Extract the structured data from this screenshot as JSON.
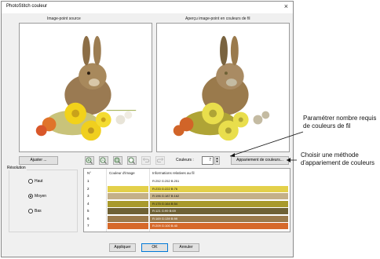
{
  "dialog": {
    "title": "PhotoStitch couleur",
    "close_glyph": "×"
  },
  "panels": {
    "source_label": "Image-point source",
    "preview_label": "Aperçu image-point en couleurs de fil",
    "source_image": "rabbit-with-flowers",
    "preview_image": "rabbit-with-flowers-thread-colors"
  },
  "toolbar": {
    "adjust_label": "Ajuster ...",
    "tools": [
      "zoom-in-icon",
      "zoom-out-icon",
      "zoom-fit-icon",
      "zoom-window-icon",
      "undo-icon",
      "redo-icon"
    ],
    "colors_label": "Couleurs :",
    "colors_value": "7",
    "matching_label": "Appariement de couleurs..."
  },
  "resolution": {
    "title": "Résolution",
    "options": [
      {
        "label": "Haut",
        "selected": false
      },
      {
        "label": "Moyen",
        "selected": true
      },
      {
        "label": "Bas",
        "selected": false
      }
    ]
  },
  "table": {
    "headers": [
      "N°",
      "Couleur d'image",
      "Informations relatives au fil"
    ],
    "rows": [
      {
        "n": "1",
        "color": "#ffffff",
        "info": "R:252 G:252 B:251",
        "row_bg": "#ffffff"
      },
      {
        "n": "2",
        "color": "#e3d04a",
        "info": "R:233 G:222 B:76",
        "row_bg": "#e3d04a"
      },
      {
        "n": "3",
        "color": "#c4b088",
        "info": "R:196 G:187 B:162",
        "row_bg": "#c4b088"
      },
      {
        "n": "4",
        "color": "#a89a2c",
        "info": "R:175 G:164 B:54",
        "row_bg": "#a89a2c"
      },
      {
        "n": "5",
        "color": "#6e6135",
        "info": "R:121 G:99 B:69",
        "row_bg": "#6e6135"
      },
      {
        "n": "6",
        "color": "#9a7a4c",
        "info": "R:169 G:139 B:99",
        "row_bg": "#9a7a4c"
      },
      {
        "n": "7",
        "color": "#d6692a",
        "info": "R:209 G:100 B:40",
        "row_bg": "#d6692a"
      }
    ]
  },
  "footer": {
    "apply_label": "Appliquer",
    "ok_label": "OK",
    "cancel_label": "Annuler"
  },
  "annotations": {
    "top": "Paramétrer nombre requis de couleurs de fil",
    "bottom": "Choisir une méthode d'appariement de couleurs"
  }
}
